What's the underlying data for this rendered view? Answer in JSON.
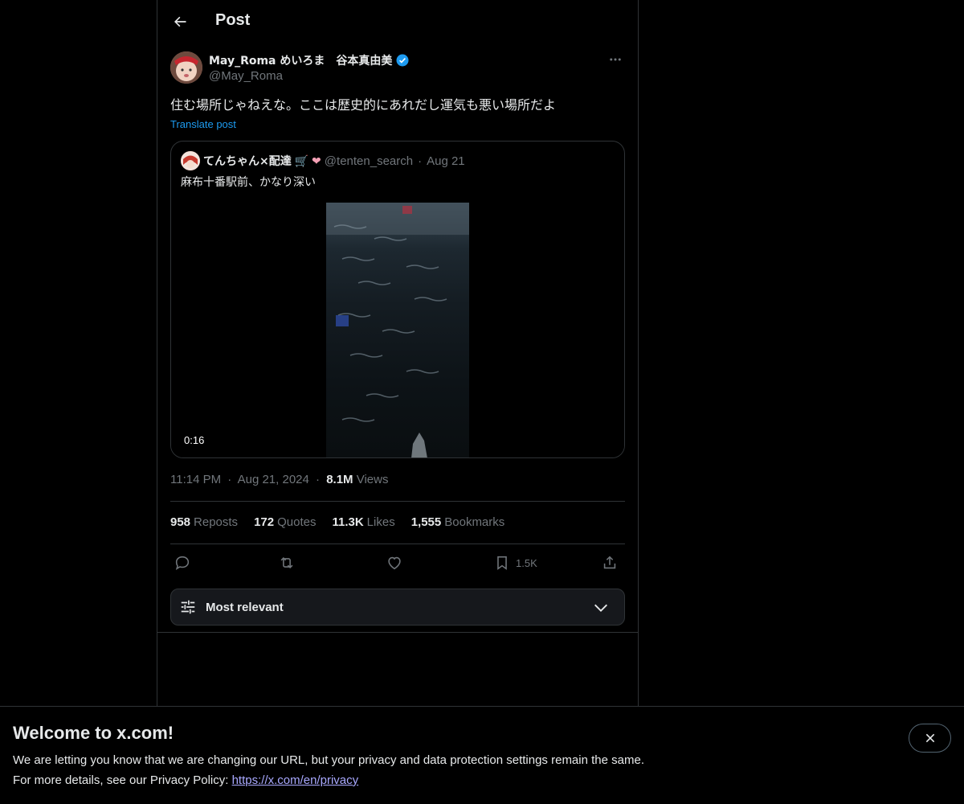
{
  "header": {
    "title": "Post"
  },
  "post": {
    "author_name": "May_Roma めいろま　谷本真由美",
    "author_handle": "@May_Roma",
    "text": "住む場所じゃねえな。ここは歴史的にあれだし運気も悪い場所だよ",
    "translate_label": "Translate post",
    "quote": {
      "name": "てんちゃん×配達",
      "emoji": "🛒 ❤",
      "handle": "@tenten_search",
      "separator": "·",
      "date": "Aug 21",
      "text": "麻布十番駅前、かなり深い",
      "video_duration": "0:16"
    },
    "time": "11:14 PM",
    "dot": "·",
    "date": "Aug 21, 2024",
    "views_count": "8.1M",
    "views_label": "Views",
    "stats": [
      {
        "count": "958",
        "label": "Reposts"
      },
      {
        "count": "172",
        "label": "Quotes"
      },
      {
        "count": "11.3K",
        "label": "Likes"
      },
      {
        "count": "1,555",
        "label": "Bookmarks"
      }
    ],
    "bookmark_count": "1.5K"
  },
  "sort": {
    "label": "Most relevant"
  },
  "banner": {
    "title": "Welcome to x.com!",
    "line1": "We are letting you know that we are changing our URL, but your privacy and data protection settings remain the same.",
    "line2_prefix": "For more details, see our Privacy Policy: ",
    "link": "https://x.com/en/privacy"
  },
  "colors": {
    "accent": "#1d9bf0",
    "background": "#000000",
    "border": "#2f3336",
    "muted": "#71767b"
  }
}
